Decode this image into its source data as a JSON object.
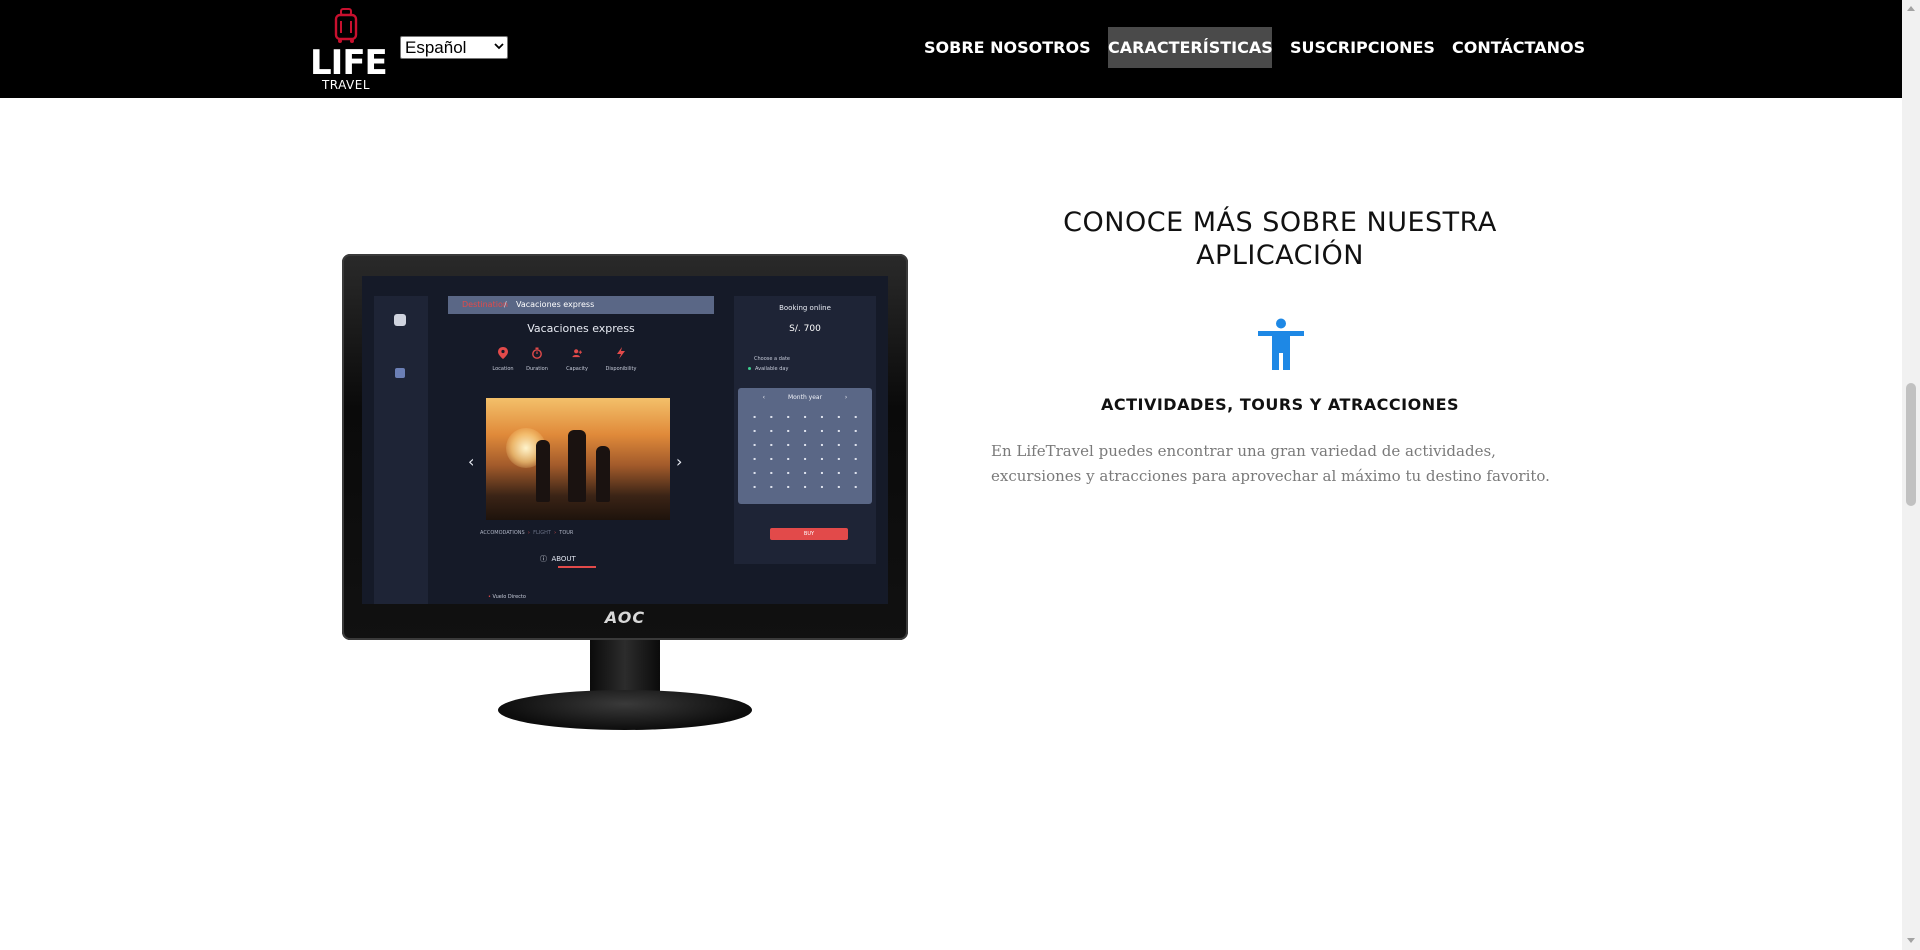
{
  "header": {
    "logo": {
      "main": "LIFE",
      "sub": "TRAVEL",
      "icon": "luggage-icon",
      "accent_color": "#c8102e"
    },
    "language_select": {
      "value": "Español"
    },
    "nav": [
      {
        "label": "SOBRE NOSOTROS",
        "active": false
      },
      {
        "label": "CARACTERÍSTICAS",
        "active": true
      },
      {
        "label": "SUSCRIPCIONES",
        "active": false
      },
      {
        "label": "CONTÁCTANOS",
        "active": false
      }
    ]
  },
  "monitor": {
    "brand": "AOC",
    "app": {
      "breadcrumb": {
        "link": "Destination",
        "separator": "/",
        "current": "Vacaciones express"
      },
      "title": "Vacaciones express",
      "features": [
        "Location",
        "Duration",
        "Capacity",
        "Disponibility"
      ],
      "steps": {
        "first": "ACCOMODATIONS",
        "second": "FLIGHT",
        "third": "TOUR"
      },
      "about_label": "ABOUT",
      "bullet_item": "Vuelo Directo",
      "booking": {
        "title": "Booking online",
        "price": "S/. 700",
        "choose_date": "Choose a date",
        "available_day": "Available day",
        "calendar_header": "Month year",
        "buy_label": "BUY"
      }
    }
  },
  "content": {
    "section_title": "CONOCE MÁS SOBRE NUESTRA APLICACIÓN",
    "feature_icon": "accessibility-person-icon",
    "feature_icon_color": "#1e88e5",
    "feature_heading": "ACTIVIDADES, TOURS Y ATRACCIONES",
    "feature_description": "En LifeTravel puedes encontrar una gran variedad de actividades, excursiones y atracciones para aprovechar al máximo tu destino favorito."
  }
}
